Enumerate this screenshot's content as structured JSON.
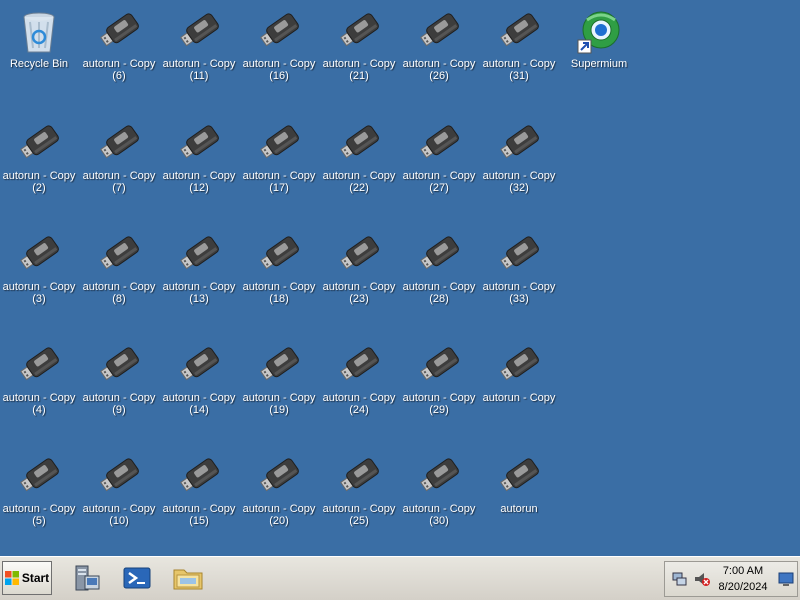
{
  "desktop": {
    "icons": [
      {
        "label": "Recycle Bin",
        "type": "recycle-bin",
        "col": 0,
        "row": 0
      },
      {
        "label": "autorun - Copy (2)",
        "type": "usb",
        "col": 0,
        "row": 1
      },
      {
        "label": "autorun - Copy (3)",
        "type": "usb",
        "col": 0,
        "row": 2
      },
      {
        "label": "autorun - Copy (4)",
        "type": "usb",
        "col": 0,
        "row": 3
      },
      {
        "label": "autorun - Copy (5)",
        "type": "usb",
        "col": 0,
        "row": 4
      },
      {
        "label": "autorun - Copy (6)",
        "type": "usb",
        "col": 1,
        "row": 0
      },
      {
        "label": "autorun - Copy (7)",
        "type": "usb",
        "col": 1,
        "row": 1
      },
      {
        "label": "autorun - Copy (8)",
        "type": "usb",
        "col": 1,
        "row": 2
      },
      {
        "label": "autorun - Copy (9)",
        "type": "usb",
        "col": 1,
        "row": 3
      },
      {
        "label": "autorun - Copy (10)",
        "type": "usb",
        "col": 1,
        "row": 4
      },
      {
        "label": "autorun - Copy (11)",
        "type": "usb",
        "col": 2,
        "row": 0
      },
      {
        "label": "autorun - Copy (12)",
        "type": "usb",
        "col": 2,
        "row": 1
      },
      {
        "label": "autorun - Copy (13)",
        "type": "usb",
        "col": 2,
        "row": 2
      },
      {
        "label": "autorun - Copy (14)",
        "type": "usb",
        "col": 2,
        "row": 3
      },
      {
        "label": "autorun - Copy (15)",
        "type": "usb",
        "col": 2,
        "row": 4
      },
      {
        "label": "autorun - Copy (16)",
        "type": "usb",
        "col": 3,
        "row": 0
      },
      {
        "label": "autorun - Copy (17)",
        "type": "usb",
        "col": 3,
        "row": 1
      },
      {
        "label": "autorun - Copy (18)",
        "type": "usb",
        "col": 3,
        "row": 2
      },
      {
        "label": "autorun - Copy (19)",
        "type": "usb",
        "col": 3,
        "row": 3
      },
      {
        "label": "autorun - Copy (20)",
        "type": "usb",
        "col": 3,
        "row": 4
      },
      {
        "label": "autorun - Copy (21)",
        "type": "usb",
        "col": 4,
        "row": 0
      },
      {
        "label": "autorun - Copy (22)",
        "type": "usb",
        "col": 4,
        "row": 1
      },
      {
        "label": "autorun - Copy (23)",
        "type": "usb",
        "col": 4,
        "row": 2
      },
      {
        "label": "autorun - Copy (24)",
        "type": "usb",
        "col": 4,
        "row": 3
      },
      {
        "label": "autorun - Copy (25)",
        "type": "usb",
        "col": 4,
        "row": 4
      },
      {
        "label": "autorun - Copy (26)",
        "type": "usb",
        "col": 5,
        "row": 0
      },
      {
        "label": "autorun - Copy (27)",
        "type": "usb",
        "col": 5,
        "row": 1
      },
      {
        "label": "autorun - Copy (28)",
        "type": "usb",
        "col": 5,
        "row": 2
      },
      {
        "label": "autorun - Copy (29)",
        "type": "usb",
        "col": 5,
        "row": 3
      },
      {
        "label": "autorun - Copy (30)",
        "type": "usb",
        "col": 5,
        "row": 4
      },
      {
        "label": "autorun - Copy (31)",
        "type": "usb",
        "col": 6,
        "row": 0
      },
      {
        "label": "autorun - Copy (32)",
        "type": "usb",
        "col": 6,
        "row": 1
      },
      {
        "label": "autorun - Copy (33)",
        "type": "usb",
        "col": 6,
        "row": 2
      },
      {
        "label": "autorun - Copy",
        "type": "usb",
        "col": 6,
        "row": 3
      },
      {
        "label": "autorun",
        "type": "usb",
        "col": 6,
        "row": 4
      },
      {
        "label": "Supermium",
        "type": "browser-shortcut",
        "col": 7,
        "row": 0
      }
    ]
  },
  "taskbar": {
    "start_label": "Start",
    "quick_launch": [
      "server-manager-icon",
      "powershell-icon",
      "explorer-folder-icon"
    ],
    "tray": {
      "icons": [
        "network-icon",
        "volume-muted-icon",
        "show-desktop-icon"
      ],
      "time": "7:00 AM",
      "date": "8/20/2024"
    }
  },
  "colors": {
    "desktop_background": "#3a6ea5",
    "taskbar": "#d4d0c8"
  }
}
